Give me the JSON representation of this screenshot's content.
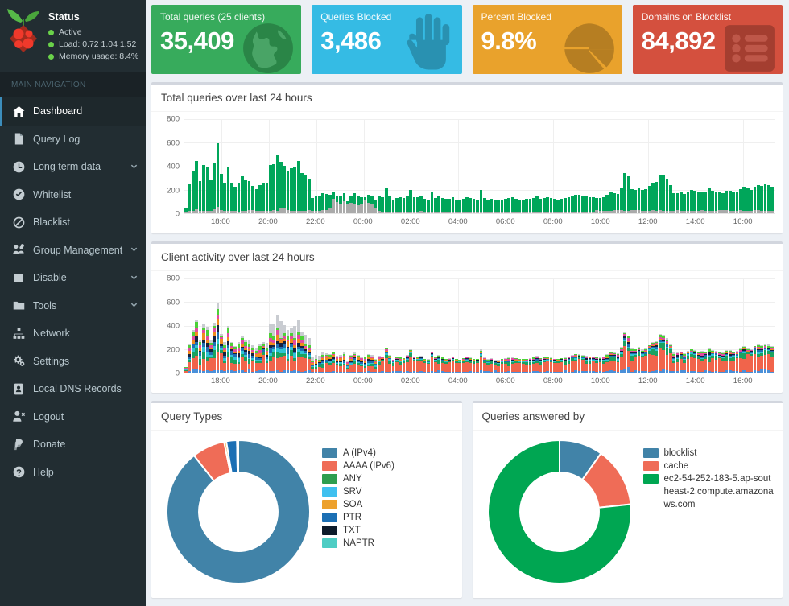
{
  "sidebar": {
    "status": {
      "title": "Status",
      "lines": [
        "Active",
        "Load:  0.72  1.04  1.52",
        "Memory usage:  8.4%"
      ]
    },
    "nav_header": "MAIN NAVIGATION",
    "items": [
      {
        "label": "Dashboard",
        "icon": "home-icon",
        "active": true,
        "caret": ""
      },
      {
        "label": "Query Log",
        "icon": "file-icon",
        "active": false,
        "caret": ""
      },
      {
        "label": "Long term data",
        "icon": "clock-icon",
        "active": false,
        "caret": "⌄"
      },
      {
        "label": "Whitelist",
        "icon": "check-circle-icon",
        "active": false,
        "caret": ""
      },
      {
        "label": "Blacklist",
        "icon": "ban-icon",
        "active": false,
        "caret": ""
      },
      {
        "label": "Group Management",
        "icon": "users-gear-icon",
        "active": false,
        "caret": "⌄"
      },
      {
        "label": "Disable",
        "icon": "square-icon",
        "active": false,
        "caret": "⌄"
      },
      {
        "label": "Tools",
        "icon": "folder-icon",
        "active": false,
        "caret": "⌄"
      },
      {
        "label": "Network",
        "icon": "sitemap-icon",
        "active": false,
        "caret": ""
      },
      {
        "label": "Settings",
        "icon": "gears-icon",
        "active": false,
        "caret": ""
      },
      {
        "label": "Local DNS Records",
        "icon": "address-book-icon",
        "active": false,
        "caret": ""
      },
      {
        "label": "Logout",
        "icon": "user-times-icon",
        "active": false,
        "caret": ""
      },
      {
        "label": "Donate",
        "icon": "paypal-icon",
        "active": false,
        "caret": ""
      },
      {
        "label": "Help",
        "icon": "question-icon",
        "active": false,
        "caret": ""
      }
    ]
  },
  "stats": [
    {
      "label": "Total queries (25 clients)",
      "value": "35,409",
      "color": "#37ab5c",
      "icon": "globe-icon"
    },
    {
      "label": "Queries Blocked",
      "value": "3,486",
      "color": "#35bbe4",
      "icon": "hand-icon"
    },
    {
      "label": "Percent Blocked",
      "value": "9.8%",
      "color": "#e9a22c",
      "icon": "pie-chart-icon"
    },
    {
      "label": "Domains on Blocklist",
      "value": "84,892",
      "color": "#d4503e",
      "icon": "list-icon"
    }
  ],
  "chart_data": [
    {
      "type": "bar",
      "id": "total-queries",
      "title": "Total queries over last 24 hours",
      "xlabel": "",
      "ylabel": "",
      "ylim": [
        0,
        800
      ],
      "yticks": [
        0,
        200,
        400,
        600,
        800
      ],
      "grid": true,
      "stacked": true,
      "legend": "none",
      "series": [
        {
          "name": "Blocked",
          "color": "#aaaaaa"
        },
        {
          "name": "Permitted",
          "color": "#00a65a"
        }
      ],
      "x_tick_labels": [
        "18:00",
        "20:00",
        "22:00",
        "00:00",
        "02:00",
        "04:00",
        "06:00",
        "08:00",
        "10:00",
        "12:00",
        "14:00",
        "16:00"
      ],
      "x_tick_positions": [
        10.5,
        24.0,
        37.5,
        51.0,
        64.5,
        78.0,
        91.5,
        105.0,
        118.5,
        132.0,
        145.5,
        159.0
      ],
      "n_bars": 168,
      "blocked": [
        12,
        18,
        22,
        35,
        20,
        24,
        18,
        22,
        36,
        55,
        26,
        24,
        20,
        22,
        18,
        16,
        20,
        24,
        30,
        28,
        24,
        20,
        22,
        18,
        22,
        25,
        20,
        40,
        45,
        30,
        24,
        22,
        20,
        18,
        24,
        26,
        20,
        22,
        24,
        28,
        26,
        40,
        120,
        95,
        85,
        100,
        75,
        88,
        80,
        70,
        72,
        118,
        90,
        85,
        40,
        20,
        12,
        10,
        14,
        12,
        10,
        9,
        11,
        10,
        9,
        8,
        10,
        20,
        9,
        10,
        11,
        9,
        10,
        9,
        11,
        10,
        9,
        8,
        10,
        9,
        11,
        10,
        9,
        10,
        11,
        9,
        8,
        10,
        9,
        11,
        10,
        9,
        8,
        10,
        9,
        10,
        11,
        9,
        10,
        9,
        8,
        10,
        9,
        11,
        10,
        9,
        8,
        10,
        9,
        11,
        10,
        9,
        10,
        9,
        8,
        10,
        12,
        25,
        18,
        22,
        20,
        18,
        30,
        28,
        26,
        22,
        20,
        30,
        28,
        26,
        24,
        22,
        20,
        26,
        24,
        30,
        22,
        20,
        18,
        22,
        26,
        24,
        20,
        18,
        22,
        24,
        20,
        26,
        22,
        20,
        18,
        22,
        28,
        30,
        26,
        22,
        20,
        24,
        26,
        22,
        20,
        24,
        30,
        26,
        22,
        20,
        24,
        22
      ],
      "total": [
        48,
        245,
        360,
        445,
        277,
        408,
        392,
        278,
        425,
        595,
        332,
        258,
        397,
        260,
        226,
        263,
        313,
        280,
        276,
        234,
        203,
        237,
        262,
        255,
        412,
        418,
        492,
        438,
        403,
        366,
        386,
        396,
        444,
        344,
        322,
        296,
        132,
        148,
        144,
        170,
        166,
        155,
        175,
        146,
        148,
        170,
        101,
        154,
        173,
        151,
        135,
        138,
        156,
        148,
        115,
        143,
        135,
        213,
        152,
        112,
        130,
        136,
        127,
        148,
        196,
        140,
        138,
        142,
        120,
        116,
        180,
        132,
        148,
        130,
        120,
        122,
        136,
        118,
        112,
        124,
        140,
        130,
        120,
        116,
        198,
        128,
        118,
        124,
        112,
        108,
        118,
        124,
        130,
        136,
        126,
        118,
        116,
        120,
        126,
        133,
        142,
        126,
        132,
        138,
        128,
        120,
        118,
        125,
        132,
        140,
        150,
        160,
        155,
        148,
        142,
        138,
        135,
        130,
        128,
        140,
        155,
        178,
        170,
        166,
        220,
        345,
        318,
        205,
        200,
        216,
        196,
        205,
        236,
        258,
        268,
        326,
        320,
        296,
        240,
        168,
        172,
        178,
        165,
        185,
        200,
        190,
        175,
        182,
        176,
        215,
        190,
        185,
        178,
        172,
        195,
        190,
        180,
        186,
        205,
        225,
        212,
        198,
        228,
        240,
        232,
        245,
        238,
        228,
        232,
        240,
        250,
        245
      ]
    },
    {
      "type": "bar",
      "id": "client-activity",
      "title": "Client activity over last 24 hours",
      "xlabel": "",
      "ylabel": "",
      "ylim": [
        0,
        800
      ],
      "yticks": [
        0,
        200,
        400,
        600,
        800
      ],
      "grid": true,
      "stacked": true,
      "legend": "none",
      "series": [
        {
          "name": "client-1",
          "color": "#4a90d9"
        },
        {
          "name": "client-2",
          "color": "#f1644b"
        },
        {
          "name": "client-3",
          "color": "#1aa260"
        },
        {
          "name": "client-4",
          "color": "#2ec4d4"
        },
        {
          "name": "client-5",
          "color": "#1f6fb2"
        },
        {
          "name": "client-6",
          "color": "#16213e"
        },
        {
          "name": "client-7",
          "color": "#f08a1e"
        },
        {
          "name": "client-8",
          "color": "#e24aa0"
        },
        {
          "name": "client-9",
          "color": "#4cd137"
        },
        {
          "name": "client-10",
          "color": "#c9ccd1"
        }
      ],
      "x_tick_labels": [
        "18:00",
        "20:00",
        "22:00",
        "00:00",
        "02:00",
        "04:00",
        "06:00",
        "08:00",
        "10:00",
        "12:00",
        "14:00",
        "16:00"
      ],
      "x_tick_positions": [
        10.5,
        24.0,
        37.5,
        51.0,
        64.5,
        78.0,
        91.5,
        105.0,
        118.5,
        132.0,
        145.5,
        159.0
      ],
      "n_bars": 168,
      "totals": [
        48,
        245,
        360,
        445,
        277,
        408,
        392,
        278,
        425,
        595,
        332,
        258,
        397,
        260,
        226,
        263,
        313,
        280,
        276,
        234,
        203,
        237,
        262,
        255,
        412,
        418,
        492,
        438,
        403,
        366,
        386,
        396,
        444,
        344,
        322,
        296,
        132,
        148,
        144,
        170,
        166,
        155,
        175,
        146,
        148,
        170,
        101,
        154,
        173,
        151,
        135,
        138,
        156,
        148,
        115,
        143,
        135,
        213,
        152,
        112,
        130,
        136,
        127,
        148,
        196,
        140,
        138,
        142,
        120,
        116,
        180,
        132,
        148,
        130,
        120,
        122,
        136,
        118,
        112,
        124,
        140,
        130,
        120,
        116,
        198,
        128,
        118,
        124,
        112,
        108,
        118,
        124,
        130,
        136,
        126,
        118,
        116,
        120,
        126,
        133,
        142,
        126,
        132,
        138,
        128,
        120,
        118,
        125,
        132,
        140,
        150,
        160,
        155,
        148,
        142,
        138,
        135,
        130,
        128,
        140,
        155,
        178,
        170,
        166,
        220,
        345,
        318,
        205,
        200,
        216,
        196,
        205,
        236,
        258,
        268,
        326,
        320,
        296,
        240,
        168,
        172,
        178,
        165,
        185,
        200,
        190,
        175,
        182,
        176,
        215,
        190,
        185,
        178,
        172,
        195,
        190,
        180,
        186,
        205,
        225,
        212,
        198,
        228,
        240,
        232,
        245,
        238,
        228,
        232,
        240,
        250,
        245
      ]
    },
    {
      "type": "pie",
      "id": "query-types",
      "title": "Query Types",
      "donut": true,
      "legend": "right",
      "labels": [
        "A (IPv4)",
        "AAAA (IPv6)",
        "ANY",
        "SRV",
        "SOA",
        "PTR",
        "TXT",
        "NAPTR"
      ],
      "colors": [
        "#4183a8",
        "#ef6c57",
        "#2e9e4f",
        "#3fc0ef",
        "#eda12d",
        "#1b6fb4",
        "#0d1b2a",
        "#4ecdc4"
      ],
      "values": [
        89.4,
        7.4,
        0.0,
        0.0,
        0.5,
        2.4,
        0.15,
        0.15
      ]
    },
    {
      "type": "pie",
      "id": "queries-answered-by",
      "title": "Queries answered by",
      "donut": true,
      "legend": "right",
      "labels": [
        "blocklist",
        "cache",
        "ec2-54-252-183-5.ap-southeast-2.compute.amazonaws.com"
      ],
      "colors": [
        "#4183a8",
        "#ef6c57",
        "#00a652"
      ],
      "values": [
        9.8,
        13.5,
        76.7
      ]
    }
  ]
}
